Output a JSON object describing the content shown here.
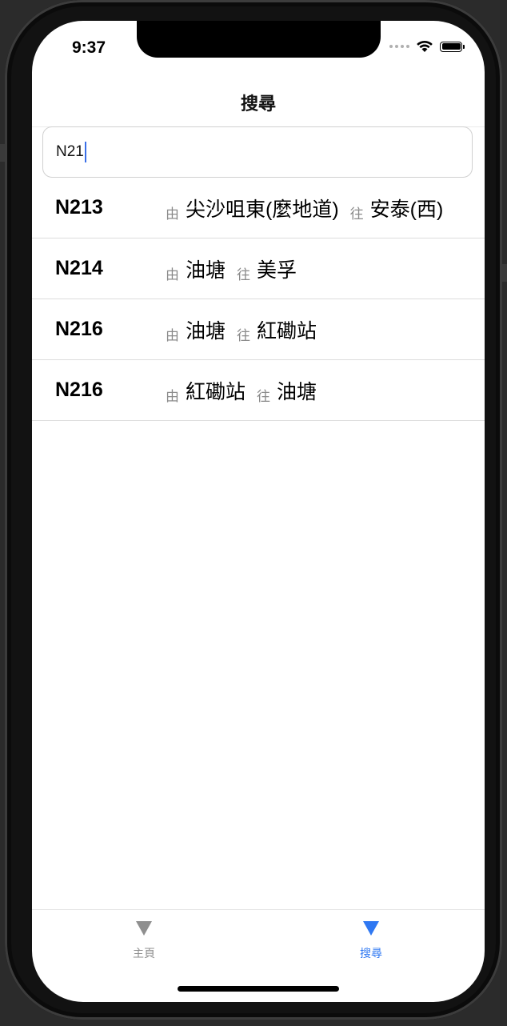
{
  "status": {
    "time": "9:37"
  },
  "nav": {
    "title": "搜尋"
  },
  "search": {
    "value": "N21"
  },
  "labels": {
    "from": "由",
    "to": "往"
  },
  "routes": [
    {
      "route": "N213",
      "from": "尖沙咀東(麼地道)",
      "to": "安泰(西)"
    },
    {
      "route": "N214",
      "from": "油塘",
      "to": "美孚"
    },
    {
      "route": "N216",
      "from": "油塘",
      "to": "紅磡站"
    },
    {
      "route": "N216",
      "from": "紅磡站",
      "to": "油塘"
    }
  ],
  "tabs": [
    {
      "label": "主頁",
      "icon": "triangle-down-icon",
      "active": false
    },
    {
      "label": "搜尋",
      "icon": "triangle-down-icon",
      "active": true
    }
  ],
  "colors": {
    "accent": "#2f78f2",
    "inactive": "#8f8f8f",
    "caret": "#3a6fe8"
  }
}
